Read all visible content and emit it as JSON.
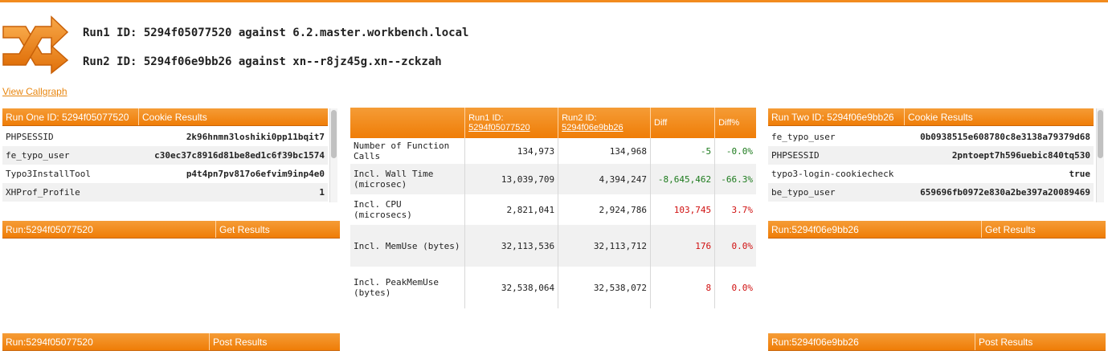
{
  "header": {
    "run1_title": "Run1 ID: 5294f05077520 against 6.2.master.workbench.local",
    "run2_title": "Run2 ID: 5294f06e9bb26 against xn--r8jz45g.xn--zckzah",
    "view_callgraph": "View Callgraph"
  },
  "left": {
    "cookie_head": {
      "col1": "Run One ID: 5294f05077520",
      "col2": "Cookie Results"
    },
    "cookies": [
      {
        "k": "PHPSESSID",
        "v": "2k96hnmn3loshiki0pp11bqit7"
      },
      {
        "k": "fe_typo_user",
        "v": "c30ec37c8916d81be8ed1c6f39bc1574"
      },
      {
        "k": "Typo3InstallTool",
        "v": "p4t4pn7pv817o6efvim9inp4e0"
      },
      {
        "k": "XHProf_Profile",
        "v": "1"
      }
    ],
    "get_head": {
      "col1": "Run:5294f05077520",
      "col2": "Get Results"
    },
    "post_head": {
      "col1": "Run:5294f05077520",
      "col2": "Post Results"
    }
  },
  "right": {
    "cookie_head": {
      "col1": "Run Two ID: 5294f06e9bb26",
      "col2": "Cookie Results"
    },
    "cookies": [
      {
        "k": "fe_typo_user",
        "v": "0b0938515e608780c8e3138a79379d68"
      },
      {
        "k": "PHPSESSID",
        "v": "2pntoept7h596uebic840tq530"
      },
      {
        "k": "typo3-login-cookiecheck",
        "v": "true"
      },
      {
        "k": "be_typo_user",
        "v": "659696fb0972e830a2be397a20089469"
      }
    ],
    "get_head": {
      "col1": "Run:5294f06e9bb26",
      "col2": "Get Results"
    },
    "post_head": {
      "col1": "Run:5294f06e9bb26",
      "col2": "Post Results"
    }
  },
  "diff_table": {
    "headers": {
      "run1_label": "Run1 ID:",
      "run1_link": "5294f05077520",
      "run2_label": "Run2 ID:",
      "run2_link": "5294f06e9bb26",
      "diff": "Diff",
      "diffpct": "Diff%"
    },
    "rows": [
      {
        "metric": "Number of Function Calls",
        "r1": "134,973",
        "r2": "134,968",
        "diff": "-5",
        "pct": "-0.0%",
        "sign": "neg"
      },
      {
        "metric": "Incl. Wall Time (microsec)",
        "r1": "13,039,709",
        "r2": "4,394,247",
        "diff": "-8,645,462",
        "pct": "-66.3%",
        "sign": "neg"
      },
      {
        "metric": "Incl. CPU (microsecs)",
        "r1": "2,821,041",
        "r2": "2,924,786",
        "diff": "103,745",
        "pct": "3.7%",
        "sign": "pos"
      },
      {
        "metric": "Incl. MemUse (bytes)",
        "r1": "32,113,536",
        "r2": "32,113,712",
        "diff": "176",
        "pct": "0.0%",
        "sign": "pos"
      },
      {
        "metric": "Incl. PeakMemUse (bytes)",
        "r1": "32,538,064",
        "r2": "32,538,072",
        "diff": "8",
        "pct": "0.0%",
        "sign": "pos"
      }
    ]
  },
  "colors": {
    "accent": "#ef7d07",
    "negative": "#1c7a1c",
    "positive": "#d01010"
  },
  "logo_icon": "shuffle-arrows-icon"
}
